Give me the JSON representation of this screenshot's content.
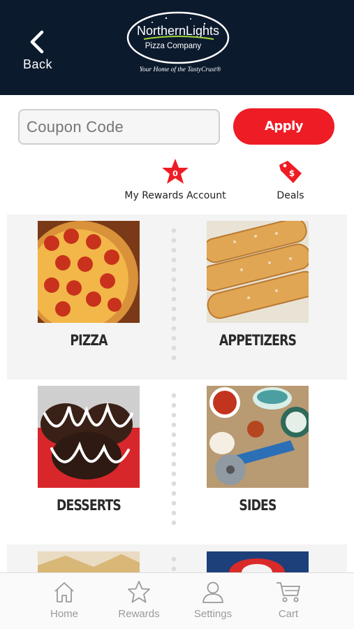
{
  "header": {
    "back_label": "Back",
    "logo": {
      "brand_line1": "NorthernLights",
      "brand_line2": "Pizza Company",
      "tagline": "Your Home of the TastyCrust®"
    },
    "background_color": "#0c1a2e"
  },
  "coupon": {
    "placeholder": "Coupon Code",
    "value": "",
    "apply_label": "Apply",
    "apply_color": "#ee1c25"
  },
  "quick_links": {
    "rewards": {
      "badge_count": "0",
      "label": "My Rewards Account",
      "icon": "star-badge-icon"
    },
    "deals": {
      "label": "Deals",
      "icon": "price-tag-icon"
    }
  },
  "categories": [
    {
      "label": "PIZZA",
      "image": "pepperoni-pizza"
    },
    {
      "label": "APPETIZERS",
      "image": "breadsticks"
    },
    {
      "label": "DESSERTS",
      "image": "chocolate-drizzle-dessert"
    },
    {
      "label": "SIDES",
      "image": "dipping-sauces-and-cutter"
    }
  ],
  "tabs": [
    {
      "label": "Home",
      "icon": "home-icon"
    },
    {
      "label": "Rewards",
      "icon": "star-icon"
    },
    {
      "label": "Settings",
      "icon": "person-icon"
    },
    {
      "label": "Cart",
      "icon": "cart-icon"
    }
  ]
}
